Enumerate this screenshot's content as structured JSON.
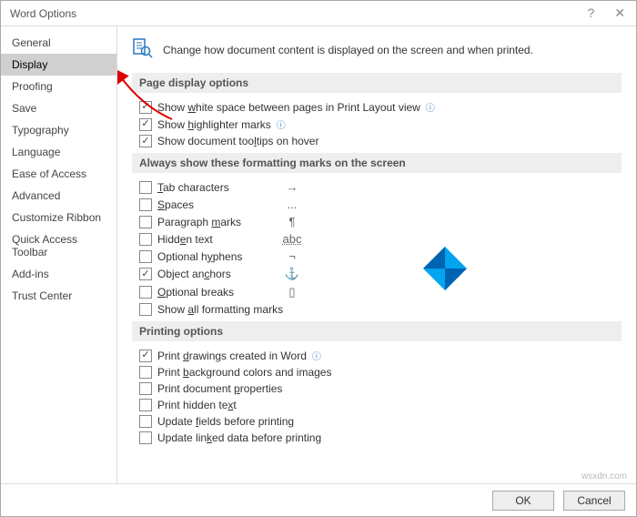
{
  "window": {
    "title": "Word Options"
  },
  "sidebar": {
    "items": [
      {
        "label": "General"
      },
      {
        "label": "Display",
        "selected": true
      },
      {
        "label": "Proofing"
      },
      {
        "label": "Save"
      },
      {
        "label": "Typography"
      },
      {
        "label": "Language"
      },
      {
        "label": "Ease of Access"
      },
      {
        "label": "Advanced"
      },
      {
        "label": "Customize Ribbon"
      },
      {
        "label": "Quick Access Toolbar"
      },
      {
        "label": "Add-ins"
      },
      {
        "label": "Trust Center"
      }
    ]
  },
  "main": {
    "intro": "Change how document content is displayed on the screen and when printed.",
    "groups": [
      {
        "title": "Page display options",
        "options": [
          {
            "pre": "Show ",
            "mn": "w",
            "post": "hite space between pages in Print Layout view",
            "checked": true,
            "info": true
          },
          {
            "pre": "Show ",
            "mn": "h",
            "post": "ighlighter marks",
            "checked": true,
            "info": true
          },
          {
            "pre": "Show document too",
            "mn": "l",
            "post": "tips on hover",
            "checked": true
          }
        ]
      },
      {
        "title": "Always show these formatting marks on the screen",
        "options": [
          {
            "mn": "T",
            "post": "ab characters",
            "sym": "→"
          },
          {
            "mn": "S",
            "post": "paces",
            "sym": "..."
          },
          {
            "pre": "Paragraph ",
            "mn": "m",
            "post": "arks",
            "sym": "¶"
          },
          {
            "pre": "Hidd",
            "mn": "e",
            "post": "n text",
            "sym": "abc",
            "symUnderline": true
          },
          {
            "pre": "Optional h",
            "mn": "y",
            "post": "phens",
            "sym": "¬"
          },
          {
            "pre": "Object an",
            "mn": "c",
            "post": "hors",
            "checked": true,
            "sym": "⚓"
          },
          {
            "mn": "O",
            "post": "ptional breaks",
            "sym": "▯"
          },
          {
            "pre": "Show ",
            "mn": "a",
            "post": "ll formatting marks"
          }
        ]
      },
      {
        "title": "Printing options",
        "options": [
          {
            "pre": "Print ",
            "mn": "d",
            "post": "rawings created in Word",
            "checked": true,
            "info": true
          },
          {
            "pre": "Print ",
            "mn": "b",
            "post": "ackground colors and images"
          },
          {
            "pre": "Print document ",
            "mn": "p",
            "post": "roperties"
          },
          {
            "pre": "Print hidden te",
            "mn": "x",
            "post": "t"
          },
          {
            "pre": "Update ",
            "mn": "f",
            "post": "ields before printing"
          },
          {
            "pre": "Update lin",
            "mn": "k",
            "post": "ed data before printing"
          }
        ]
      }
    ]
  },
  "footer": {
    "ok": "OK",
    "cancel": "Cancel"
  },
  "watermark": "wsxdn.com"
}
